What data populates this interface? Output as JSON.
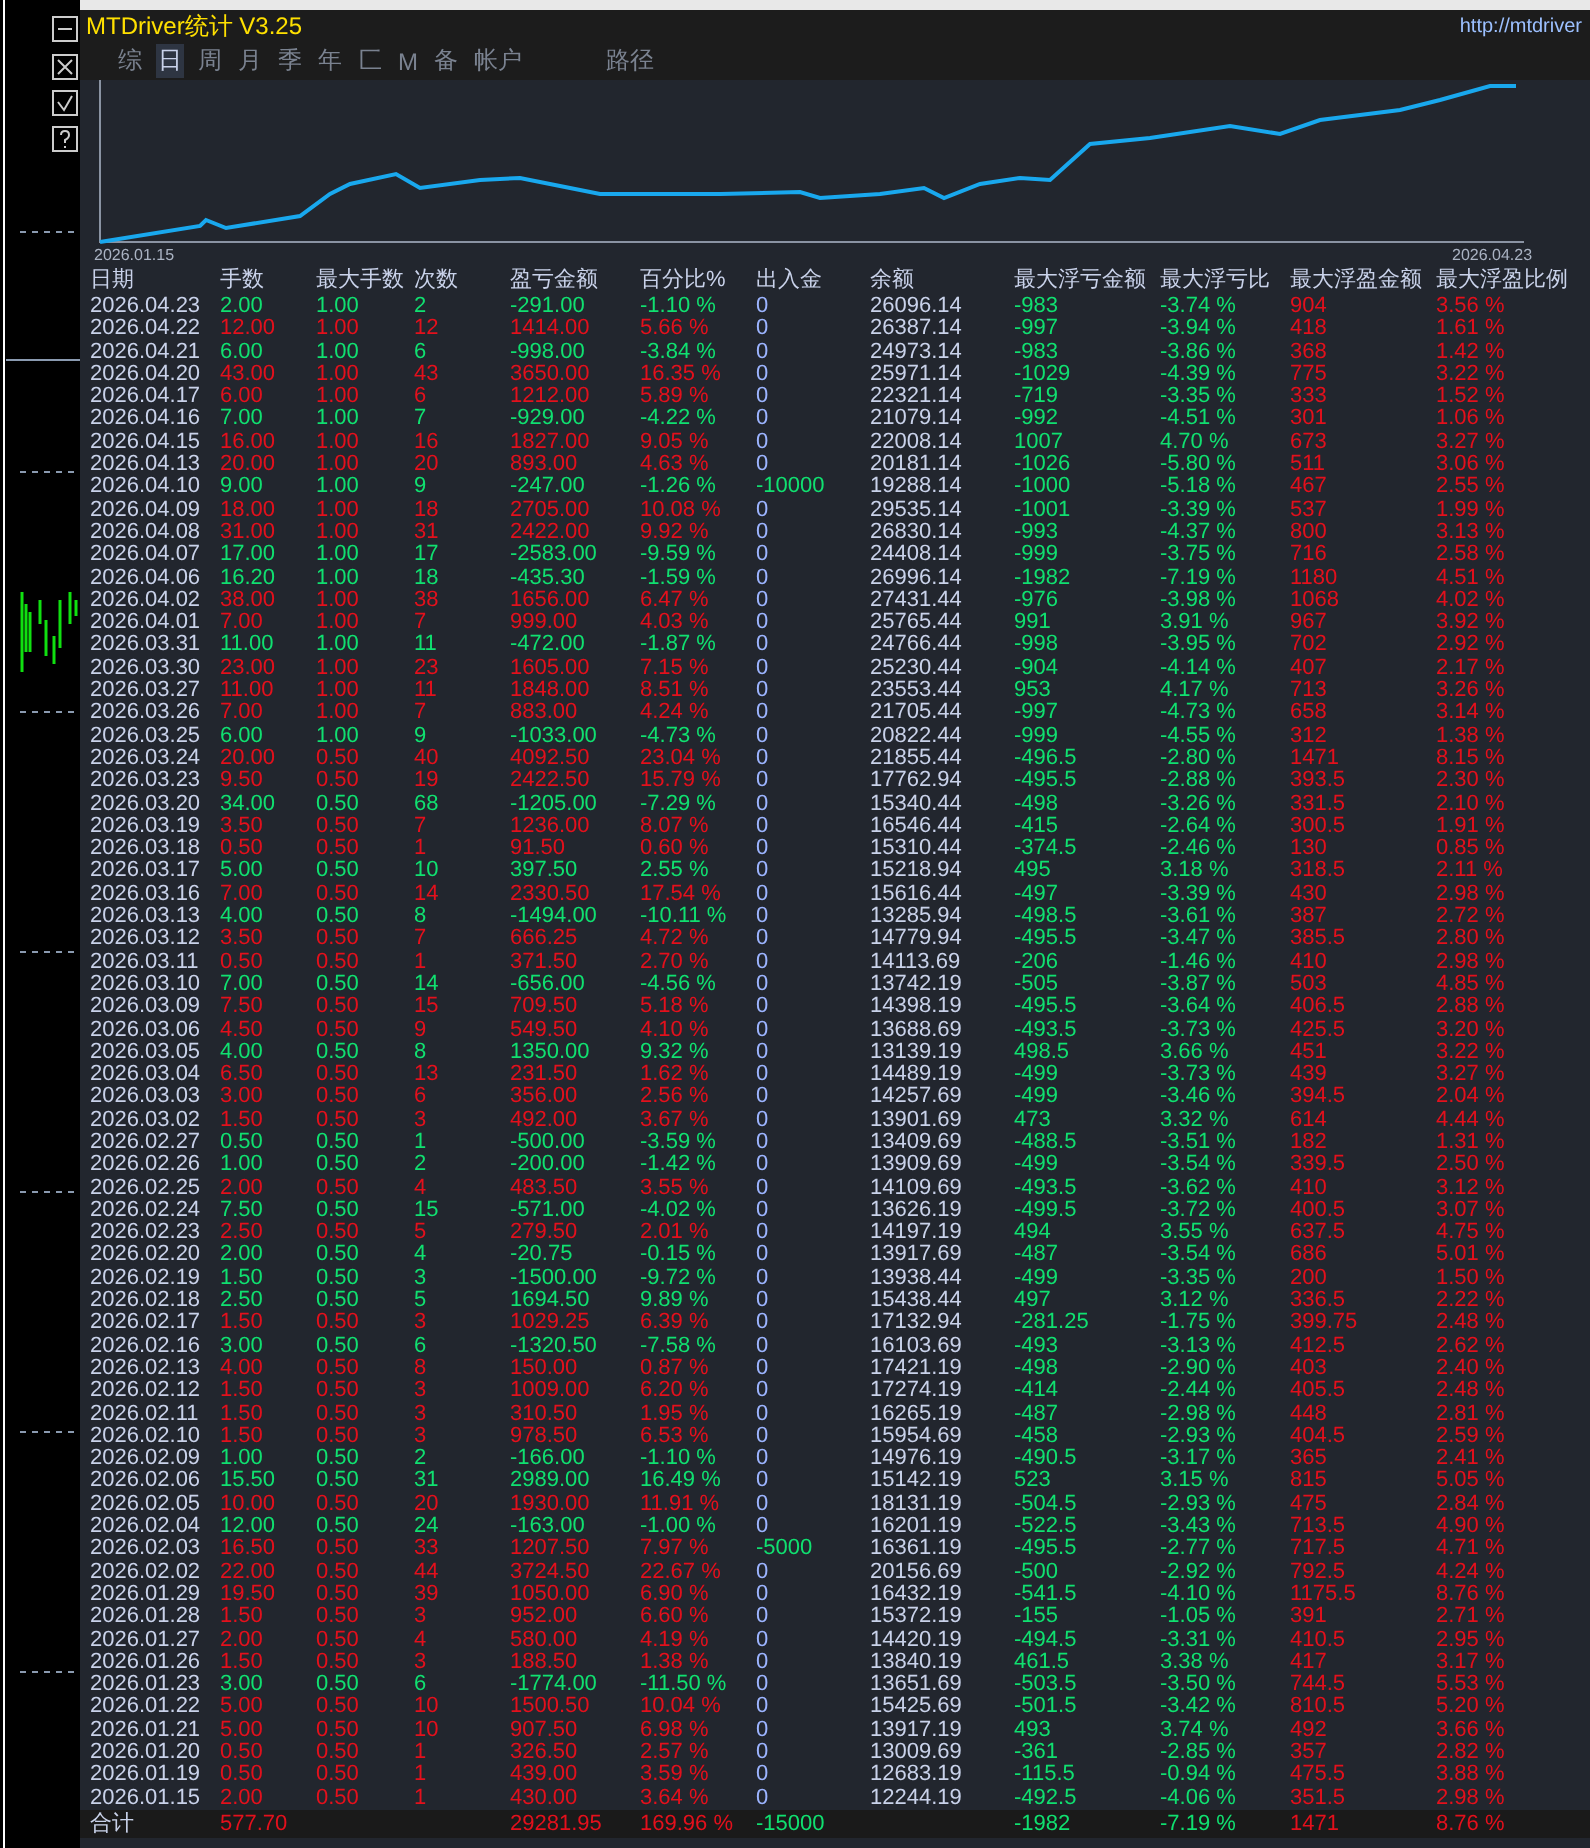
{
  "header": {
    "title": "MTDriver统计 V3.25",
    "link": "http://mtdriver"
  },
  "tabs": [
    {
      "label": "综",
      "selected": false
    },
    {
      "label": "日",
      "selected": true
    },
    {
      "label": "周",
      "selected": false
    },
    {
      "label": "月",
      "selected": false
    },
    {
      "label": "季",
      "selected": false
    },
    {
      "label": "年",
      "selected": false
    },
    {
      "label": "匚",
      "selected": false
    },
    {
      "label": "M",
      "selected": false
    },
    {
      "label": "备",
      "selected": false
    },
    {
      "label": "帐户",
      "selected": false
    },
    {
      "label": "路径",
      "selected": false
    }
  ],
  "equity_chart": {
    "start_label": "2026.01.15",
    "end_label": "2026.04.23"
  },
  "table": {
    "columns": [
      "日期",
      "手数",
      "最大手数",
      "次数",
      "盈亏金额",
      "百分比%",
      "出入金",
      "余额",
      "最大浮亏金额",
      "最大浮亏比",
      "最大浮盈金额",
      "最大浮盈比例"
    ],
    "rows": [
      {
        "kind": "loss",
        "transfer": false,
        "cells": [
          "2026.04.23",
          "2.00",
          "1.00",
          "2",
          "-291.00",
          "-1.10 %",
          "0",
          "26096.14",
          "-983",
          "-3.74 %",
          "904",
          "3.56 %"
        ]
      },
      {
        "kind": "gain",
        "transfer": false,
        "cells": [
          "2026.04.22",
          "12.00",
          "1.00",
          "12",
          "1414.00",
          "5.66 %",
          "0",
          "26387.14",
          "-997",
          "-3.94 %",
          "418",
          "1.61 %"
        ]
      },
      {
        "kind": "loss",
        "transfer": false,
        "cells": [
          "2026.04.21",
          "6.00",
          "1.00",
          "6",
          "-998.00",
          "-3.84 %",
          "0",
          "24973.14",
          "-983",
          "-3.86 %",
          "368",
          "1.42 %"
        ]
      },
      {
        "kind": "gain",
        "transfer": false,
        "cells": [
          "2026.04.20",
          "43.00",
          "1.00",
          "43",
          "3650.00",
          "16.35 %",
          "0",
          "25971.14",
          "-1029",
          "-4.39 %",
          "775",
          "3.22 %"
        ]
      },
      {
        "kind": "gain",
        "transfer": false,
        "cells": [
          "2026.04.17",
          "6.00",
          "1.00",
          "6",
          "1212.00",
          "5.89 %",
          "0",
          "22321.14",
          "-719",
          "-3.35 %",
          "333",
          "1.52 %"
        ]
      },
      {
        "kind": "loss",
        "transfer": false,
        "cells": [
          "2026.04.16",
          "7.00",
          "1.00",
          "7",
          "-929.00",
          "-4.22 %",
          "0",
          "21079.14",
          "-992",
          "-4.51 %",
          "301",
          "1.06 %"
        ]
      },
      {
        "kind": "gain",
        "transfer": false,
        "cells": [
          "2026.04.15",
          "16.00",
          "1.00",
          "16",
          "1827.00",
          "9.05 %",
          "0",
          "22008.14",
          "1007",
          "4.70 %",
          "673",
          "3.27 %"
        ]
      },
      {
        "kind": "gain",
        "transfer": false,
        "cells": [
          "2026.04.13",
          "20.00",
          "1.00",
          "20",
          "893.00",
          "4.63 %",
          "0",
          "20181.14",
          "-1026",
          "-5.80 %",
          "511",
          "3.06 %"
        ]
      },
      {
        "kind": "loss",
        "transfer": true,
        "cells": [
          "2026.04.10",
          "9.00",
          "1.00",
          "9",
          "-247.00",
          "-1.26 %",
          "-10000",
          "19288.14",
          "-1000",
          "-5.18 %",
          "467",
          "2.55 %"
        ]
      },
      {
        "kind": "gain",
        "transfer": false,
        "cells": [
          "2026.04.09",
          "18.00",
          "1.00",
          "18",
          "2705.00",
          "10.08 %",
          "0",
          "29535.14",
          "-1001",
          "-3.39 %",
          "537",
          "1.99 %"
        ]
      },
      {
        "kind": "gain",
        "transfer": false,
        "cells": [
          "2026.04.08",
          "31.00",
          "1.00",
          "31",
          "2422.00",
          "9.92 %",
          "0",
          "26830.14",
          "-993",
          "-4.37 %",
          "800",
          "3.13 %"
        ]
      },
      {
        "kind": "loss",
        "transfer": false,
        "cells": [
          "2026.04.07",
          "17.00",
          "1.00",
          "17",
          "-2583.00",
          "-9.59 %",
          "0",
          "24408.14",
          "-999",
          "-3.75 %",
          "716",
          "2.58 %"
        ]
      },
      {
        "kind": "loss",
        "transfer": false,
        "cells": [
          "2026.04.06",
          "16.20",
          "1.00",
          "18",
          "-435.30",
          "-1.59 %",
          "0",
          "26996.14",
          "-1982",
          "-7.19 %",
          "1180",
          "4.51 %"
        ]
      },
      {
        "kind": "gain",
        "transfer": false,
        "cells": [
          "2026.04.02",
          "38.00",
          "1.00",
          "38",
          "1656.00",
          "6.47 %",
          "0",
          "27431.44",
          "-976",
          "-3.98 %",
          "1068",
          "4.02 %"
        ]
      },
      {
        "kind": "gain",
        "transfer": false,
        "cells": [
          "2026.04.01",
          "7.00",
          "1.00",
          "7",
          "999.00",
          "4.03 %",
          "0",
          "25765.44",
          "991",
          "3.91 %",
          "967",
          "3.92 %"
        ]
      },
      {
        "kind": "loss",
        "transfer": false,
        "cells": [
          "2026.03.31",
          "11.00",
          "1.00",
          "11",
          "-472.00",
          "-1.87 %",
          "0",
          "24766.44",
          "-998",
          "-3.95 %",
          "702",
          "2.92 %"
        ]
      },
      {
        "kind": "gain",
        "transfer": false,
        "cells": [
          "2026.03.30",
          "23.00",
          "1.00",
          "23",
          "1605.00",
          "7.15 %",
          "0",
          "25230.44",
          "-904",
          "-4.14 %",
          "407",
          "2.17 %"
        ]
      },
      {
        "kind": "gain",
        "transfer": false,
        "cells": [
          "2026.03.27",
          "11.00",
          "1.00",
          "11",
          "1848.00",
          "8.51 %",
          "0",
          "23553.44",
          "953",
          "4.17 %",
          "713",
          "3.26 %"
        ]
      },
      {
        "kind": "gain",
        "transfer": false,
        "cells": [
          "2026.03.26",
          "7.00",
          "1.00",
          "7",
          "883.00",
          "4.24 %",
          "0",
          "21705.44",
          "-997",
          "-4.73 %",
          "658",
          "3.14 %"
        ]
      },
      {
        "kind": "loss",
        "transfer": false,
        "cells": [
          "2026.03.25",
          "6.00",
          "1.00",
          "9",
          "-1033.00",
          "-4.73 %",
          "0",
          "20822.44",
          "-999",
          "-4.55 %",
          "312",
          "1.38 %"
        ]
      },
      {
        "kind": "gain",
        "transfer": false,
        "cells": [
          "2026.03.24",
          "20.00",
          "0.50",
          "40",
          "4092.50",
          "23.04 %",
          "0",
          "21855.44",
          "-496.5",
          "-2.80 %",
          "1471",
          "8.15 %"
        ]
      },
      {
        "kind": "gain",
        "transfer": false,
        "cells": [
          "2026.03.23",
          "9.50",
          "0.50",
          "19",
          "2422.50",
          "15.79 %",
          "0",
          "17762.94",
          "-495.5",
          "-2.88 %",
          "393.5",
          "2.30 %"
        ]
      },
      {
        "kind": "loss",
        "transfer": false,
        "cells": [
          "2026.03.20",
          "34.00",
          "0.50",
          "68",
          "-1205.00",
          "-7.29 %",
          "0",
          "15340.44",
          "-498",
          "-3.26 %",
          "331.5",
          "2.10 %"
        ]
      },
      {
        "kind": "gain",
        "transfer": false,
        "cells": [
          "2026.03.19",
          "3.50",
          "0.50",
          "7",
          "1236.00",
          "8.07 %",
          "0",
          "16546.44",
          "-415",
          "-2.64 %",
          "300.5",
          "1.91 %"
        ]
      },
      {
        "kind": "gain",
        "transfer": false,
        "cells": [
          "2026.03.18",
          "0.50",
          "0.50",
          "1",
          "91.50",
          "0.60 %",
          "0",
          "15310.44",
          "-374.5",
          "-2.46 %",
          "130",
          "0.85 %"
        ]
      },
      {
        "kind": "loss",
        "transfer": false,
        "cells": [
          "2026.03.17",
          "5.00",
          "0.50",
          "10",
          "397.50",
          "2.55 %",
          "0",
          "15218.94",
          "495",
          "3.18 %",
          "318.5",
          "2.11 %"
        ]
      },
      {
        "kind": "gain",
        "transfer": false,
        "cells": [
          "2026.03.16",
          "7.00",
          "0.50",
          "14",
          "2330.50",
          "17.54 %",
          "0",
          "15616.44",
          "-497",
          "-3.39 %",
          "430",
          "2.98 %"
        ]
      },
      {
        "kind": "loss",
        "transfer": false,
        "cells": [
          "2026.03.13",
          "4.00",
          "0.50",
          "8",
          "-1494.00",
          "-10.11 %",
          "0",
          "13285.94",
          "-498.5",
          "-3.61 %",
          "387",
          "2.72 %"
        ]
      },
      {
        "kind": "gain",
        "transfer": false,
        "cells": [
          "2026.03.12",
          "3.50",
          "0.50",
          "7",
          "666.25",
          "4.72 %",
          "0",
          "14779.94",
          "-495.5",
          "-3.47 %",
          "385.5",
          "2.80 %"
        ]
      },
      {
        "kind": "gain",
        "transfer": false,
        "cells": [
          "2026.03.11",
          "0.50",
          "0.50",
          "1",
          "371.50",
          "2.70 %",
          "0",
          "14113.69",
          "-206",
          "-1.46 %",
          "410",
          "2.98 %"
        ]
      },
      {
        "kind": "loss",
        "transfer": false,
        "cells": [
          "2026.03.10",
          "7.00",
          "0.50",
          "14",
          "-656.00",
          "-4.56 %",
          "0",
          "13742.19",
          "-505",
          "-3.87 %",
          "503",
          "4.85 %"
        ]
      },
      {
        "kind": "gain",
        "transfer": false,
        "cells": [
          "2026.03.09",
          "7.50",
          "0.50",
          "15",
          "709.50",
          "5.18 %",
          "0",
          "14398.19",
          "-495.5",
          "-3.64 %",
          "406.5",
          "2.88 %"
        ]
      },
      {
        "kind": "gain",
        "transfer": false,
        "cells": [
          "2026.03.06",
          "4.50",
          "0.50",
          "9",
          "549.50",
          "4.10 %",
          "0",
          "13688.69",
          "-493.5",
          "-3.73 %",
          "425.5",
          "3.20 %"
        ]
      },
      {
        "kind": "loss",
        "transfer": false,
        "cells": [
          "2026.03.05",
          "4.00",
          "0.50",
          "8",
          "1350.00",
          "9.32 %",
          "0",
          "13139.19",
          "498.5",
          "3.66 %",
          "451",
          "3.22 %"
        ]
      },
      {
        "kind": "gain",
        "transfer": false,
        "cells": [
          "2026.03.04",
          "6.50",
          "0.50",
          "13",
          "231.50",
          "1.62 %",
          "0",
          "14489.19",
          "-499",
          "-3.73 %",
          "439",
          "3.27 %"
        ]
      },
      {
        "kind": "gain",
        "transfer": false,
        "cells": [
          "2026.03.03",
          "3.00",
          "0.50",
          "6",
          "356.00",
          "2.56 %",
          "0",
          "14257.69",
          "-499",
          "-3.46 %",
          "394.5",
          "2.04 %"
        ]
      },
      {
        "kind": "gain",
        "transfer": false,
        "cells": [
          "2026.03.02",
          "1.50",
          "0.50",
          "3",
          "492.00",
          "3.67 %",
          "0",
          "13901.69",
          "473",
          "3.32 %",
          "614",
          "4.44 %"
        ]
      },
      {
        "kind": "loss",
        "transfer": false,
        "cells": [
          "2026.02.27",
          "0.50",
          "0.50",
          "1",
          "-500.00",
          "-3.59 %",
          "0",
          "13409.69",
          "-488.5",
          "-3.51 %",
          "182",
          "1.31 %"
        ]
      },
      {
        "kind": "loss",
        "transfer": false,
        "cells": [
          "2026.02.26",
          "1.00",
          "0.50",
          "2",
          "-200.00",
          "-1.42 %",
          "0",
          "13909.69",
          "-499",
          "-3.54 %",
          "339.5",
          "2.50 %"
        ]
      },
      {
        "kind": "gain",
        "transfer": false,
        "cells": [
          "2026.02.25",
          "2.00",
          "0.50",
          "4",
          "483.50",
          "3.55 %",
          "0",
          "14109.69",
          "-493.5",
          "-3.62 %",
          "410",
          "3.12 %"
        ]
      },
      {
        "kind": "loss",
        "transfer": false,
        "cells": [
          "2026.02.24",
          "7.50",
          "0.50",
          "15",
          "-571.00",
          "-4.02 %",
          "0",
          "13626.19",
          "-499.5",
          "-3.72 %",
          "400.5",
          "3.07 %"
        ]
      },
      {
        "kind": "gain",
        "transfer": false,
        "cells": [
          "2026.02.23",
          "2.50",
          "0.50",
          "5",
          "279.50",
          "2.01 %",
          "0",
          "14197.19",
          "494",
          "3.55 %",
          "637.5",
          "4.75 %"
        ]
      },
      {
        "kind": "loss",
        "transfer": false,
        "cells": [
          "2026.02.20",
          "2.00",
          "0.50",
          "4",
          "-20.75",
          "-0.15 %",
          "0",
          "13917.69",
          "-487",
          "-3.54 %",
          "686",
          "5.01 %"
        ]
      },
      {
        "kind": "loss",
        "transfer": false,
        "cells": [
          "2026.02.19",
          "1.50",
          "0.50",
          "3",
          "-1500.00",
          "-9.72 %",
          "0",
          "13938.44",
          "-499",
          "-3.35 %",
          "200",
          "1.50 %"
        ]
      },
      {
        "kind": "loss",
        "transfer": false,
        "cells": [
          "2026.02.18",
          "2.50",
          "0.50",
          "5",
          "1694.50",
          "9.89 %",
          "0",
          "15438.44",
          "497",
          "3.12 %",
          "336.5",
          "2.22 %"
        ]
      },
      {
        "kind": "gain",
        "transfer": false,
        "cells": [
          "2026.02.17",
          "1.50",
          "0.50",
          "3",
          "1029.25",
          "6.39 %",
          "0",
          "17132.94",
          "-281.25",
          "-1.75 %",
          "399.75",
          "2.48 %"
        ]
      },
      {
        "kind": "loss",
        "transfer": false,
        "cells": [
          "2026.02.16",
          "3.00",
          "0.50",
          "6",
          "-1320.50",
          "-7.58 %",
          "0",
          "16103.69",
          "-493",
          "-3.13 %",
          "412.5",
          "2.62 %"
        ]
      },
      {
        "kind": "gain",
        "transfer": false,
        "cells": [
          "2026.02.13",
          "4.00",
          "0.50",
          "8",
          "150.00",
          "0.87 %",
          "0",
          "17421.19",
          "-498",
          "-2.90 %",
          "403",
          "2.40 %"
        ]
      },
      {
        "kind": "gain",
        "transfer": false,
        "cells": [
          "2026.02.12",
          "1.50",
          "0.50",
          "3",
          "1009.00",
          "6.20 %",
          "0",
          "17274.19",
          "-414",
          "-2.44 %",
          "405.5",
          "2.48 %"
        ]
      },
      {
        "kind": "gain",
        "transfer": false,
        "cells": [
          "2026.02.11",
          "1.50",
          "0.50",
          "3",
          "310.50",
          "1.95 %",
          "0",
          "16265.19",
          "-487",
          "-2.98 %",
          "448",
          "2.81 %"
        ]
      },
      {
        "kind": "gain",
        "transfer": false,
        "cells": [
          "2026.02.10",
          "1.50",
          "0.50",
          "3",
          "978.50",
          "6.53 %",
          "0",
          "15954.69",
          "-458",
          "-2.93 %",
          "404.5",
          "2.59 %"
        ]
      },
      {
        "kind": "loss",
        "transfer": false,
        "cells": [
          "2026.02.09",
          "1.00",
          "0.50",
          "2",
          "-166.00",
          "-1.10 %",
          "0",
          "14976.19",
          "-490.5",
          "-3.17 %",
          "365",
          "2.41 %"
        ]
      },
      {
        "kind": "loss",
        "transfer": false,
        "cells": [
          "2026.02.06",
          "15.50",
          "0.50",
          "31",
          "2989.00",
          "16.49 %",
          "0",
          "15142.19",
          "523",
          "3.15 %",
          "815",
          "5.05 %"
        ]
      },
      {
        "kind": "gain",
        "transfer": false,
        "cells": [
          "2026.02.05",
          "10.00",
          "0.50",
          "20",
          "1930.00",
          "11.91 %",
          "0",
          "18131.19",
          "-504.5",
          "-2.93 %",
          "475",
          "2.84 %"
        ]
      },
      {
        "kind": "loss",
        "transfer": false,
        "cells": [
          "2026.02.04",
          "12.00",
          "0.50",
          "24",
          "-163.00",
          "-1.00 %",
          "0",
          "16201.19",
          "-522.5",
          "-3.43 %",
          "713.5",
          "4.90 %"
        ]
      },
      {
        "kind": "gain",
        "transfer": true,
        "cells": [
          "2026.02.03",
          "16.50",
          "0.50",
          "33",
          "1207.50",
          "7.97 %",
          "-5000",
          "16361.19",
          "-495.5",
          "-2.77 %",
          "717.5",
          "4.71 %"
        ]
      },
      {
        "kind": "gain",
        "transfer": false,
        "cells": [
          "2026.02.02",
          "22.00",
          "0.50",
          "44",
          "3724.50",
          "22.67 %",
          "0",
          "20156.69",
          "-500",
          "-2.92 %",
          "792.5",
          "4.24 %"
        ]
      },
      {
        "kind": "gain",
        "transfer": false,
        "cells": [
          "2026.01.29",
          "19.50",
          "0.50",
          "39",
          "1050.00",
          "6.90 %",
          "0",
          "16432.19",
          "-541.5",
          "-4.10 %",
          "1175.5",
          "8.76 %"
        ]
      },
      {
        "kind": "gain",
        "transfer": false,
        "cells": [
          "2026.01.28",
          "1.50",
          "0.50",
          "3",
          "952.00",
          "6.60 %",
          "0",
          "15372.19",
          "-155",
          "-1.05 %",
          "391",
          "2.71 %"
        ]
      },
      {
        "kind": "gain",
        "transfer": false,
        "cells": [
          "2026.01.27",
          "2.00",
          "0.50",
          "4",
          "580.00",
          "4.19 %",
          "0",
          "14420.19",
          "-494.5",
          "-3.31 %",
          "410.5",
          "2.95 %"
        ]
      },
      {
        "kind": "gain",
        "transfer": false,
        "cells": [
          "2026.01.26",
          "1.50",
          "0.50",
          "3",
          "188.50",
          "1.38 %",
          "0",
          "13840.19",
          "461.5",
          "3.38 %",
          "417",
          "3.17 %"
        ]
      },
      {
        "kind": "loss",
        "transfer": false,
        "cells": [
          "2026.01.23",
          "3.00",
          "0.50",
          "6",
          "-1774.00",
          "-11.50 %",
          "0",
          "13651.69",
          "-503.5",
          "-3.50 %",
          "744.5",
          "5.53 %"
        ]
      },
      {
        "kind": "gain",
        "transfer": false,
        "cells": [
          "2026.01.22",
          "5.00",
          "0.50",
          "10",
          "1500.50",
          "10.04 %",
          "0",
          "15425.69",
          "-501.5",
          "-3.42 %",
          "810.5",
          "5.20 %"
        ]
      },
      {
        "kind": "gain",
        "transfer": false,
        "cells": [
          "2026.01.21",
          "5.00",
          "0.50",
          "10",
          "907.50",
          "6.98 %",
          "0",
          "13917.19",
          "493",
          "3.74 %",
          "492",
          "3.66 %"
        ]
      },
      {
        "kind": "gain",
        "transfer": false,
        "cells": [
          "2026.01.20",
          "0.50",
          "0.50",
          "1",
          "326.50",
          "2.57 %",
          "0",
          "13009.69",
          "-361",
          "-2.85 %",
          "357",
          "2.82 %"
        ]
      },
      {
        "kind": "gain",
        "transfer": false,
        "cells": [
          "2026.01.19",
          "0.50",
          "0.50",
          "1",
          "439.00",
          "3.59 %",
          "0",
          "12683.19",
          "-115.5",
          "-0.94 %",
          "475.5",
          "3.88 %"
        ]
      },
      {
        "kind": "gain",
        "transfer": false,
        "cells": [
          "2026.01.15",
          "2.00",
          "0.50",
          "1",
          "430.00",
          "3.64 %",
          "0",
          "12244.19",
          "-492.5",
          "-4.06 %",
          "351.5",
          "2.98 %"
        ]
      }
    ],
    "total": {
      "kind": "gain",
      "transfer": true,
      "label": "合计",
      "lots": "577.70",
      "profit": "29281.95",
      "percent": "169.96 %",
      "transfer_amount": "-15000",
      "max_loss": "-1982",
      "max_loss_percent": "-7.19 %",
      "max_profit": "1471",
      "max_profit_percent": "8.76 %"
    }
  }
}
